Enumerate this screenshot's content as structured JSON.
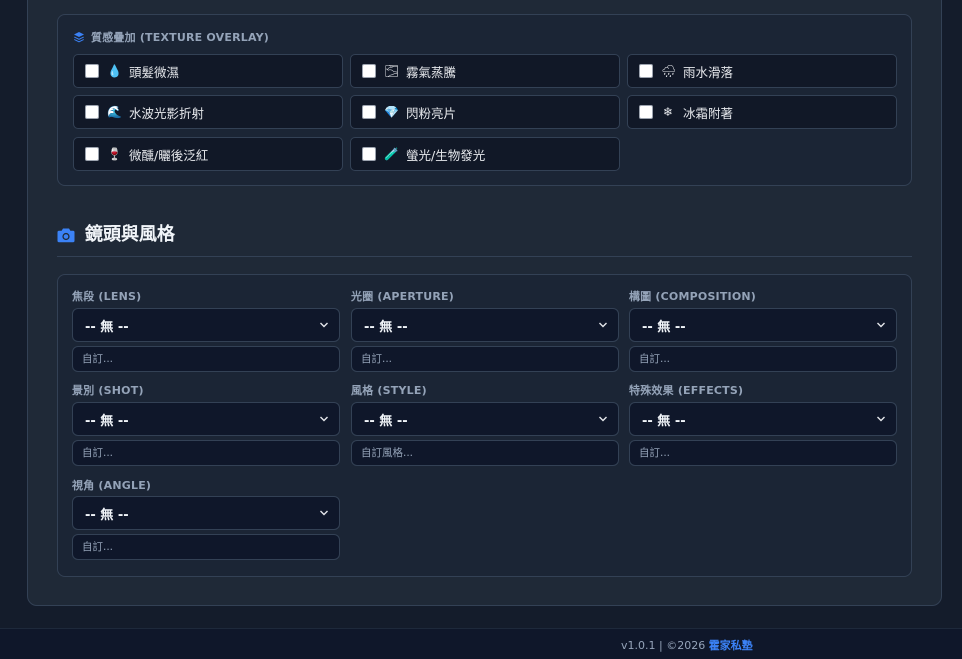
{
  "texture": {
    "title": "質感疊加 (TEXTURE OVERLAY)",
    "icon": "layers-icon",
    "items": [
      {
        "label": "頭髮微濕",
        "emoji": "💧",
        "checked": false
      },
      {
        "label": "霧氣蒸騰",
        "emoji": "🌫",
        "checked": false
      },
      {
        "label": "雨水滑落",
        "emoji": "🌧",
        "checked": false
      },
      {
        "label": "水波光影折射",
        "emoji": "🌊",
        "checked": false
      },
      {
        "label": "閃粉亮片",
        "emoji": "💎",
        "checked": false
      },
      {
        "label": "冰霜附著",
        "emoji": "❄",
        "checked": false
      },
      {
        "label": "微醺/曬後泛紅",
        "emoji": "🍷",
        "checked": false
      },
      {
        "label": "螢光/生物發光",
        "emoji": "🧪",
        "checked": false
      }
    ]
  },
  "lens_section": {
    "title": "鏡頭與風格",
    "icon": "camera-icon",
    "fields": [
      {
        "label": "焦段 (LENS)",
        "value": "-- 無 --",
        "placeholder": "自訂..."
      },
      {
        "label": "光圈 (APERTURE)",
        "value": "-- 無 --",
        "placeholder": "自訂..."
      },
      {
        "label": "構圖 (COMPOSITION)",
        "value": "-- 無 --",
        "placeholder": "自訂..."
      },
      {
        "label": "景別 (SHOT)",
        "value": "-- 無 --",
        "placeholder": "自訂..."
      },
      {
        "label": "風格 (STYLE)",
        "value": "-- 無 --",
        "placeholder": "自訂風格..."
      },
      {
        "label": "特殊效果 (EFFECTS)",
        "value": "-- 無 --",
        "placeholder": "自訂..."
      },
      {
        "label": "視角 (ANGLE)",
        "value": "-- 無 --",
        "placeholder": "自訂..."
      }
    ]
  },
  "footer": {
    "version": "v1.0.1 | ©2026",
    "brand": "霍家私塾"
  },
  "colors": {
    "accent": "#3b82f6",
    "background": "#141c2b",
    "card": "#1f2937",
    "input": "#0f172a"
  }
}
